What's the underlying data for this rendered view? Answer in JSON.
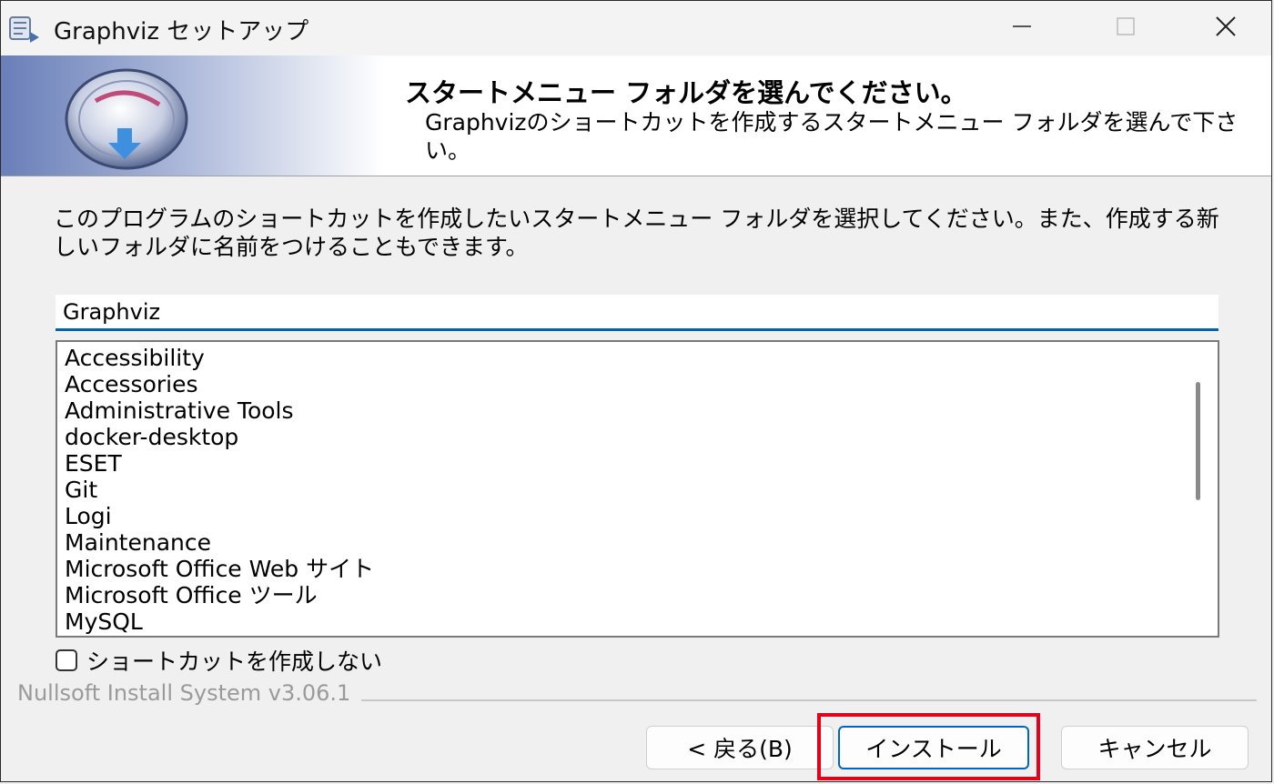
{
  "window": {
    "title": "Graphviz セットアップ",
    "icons": {
      "app": "installer-icon",
      "minimize": "minimize-icon",
      "maximize": "maximize-icon",
      "close": "close-icon"
    }
  },
  "banner": {
    "title": "スタートメニュー フォルダを選んでください。",
    "subtitle": "Graphvizのショートカットを作成するスタートメニュー フォルダを選んで下さい。"
  },
  "description": "このプログラムのショートカットを作成したいスタートメニュー フォルダを選択してください。また、作成する新しいフォルダに名前をつけることもできます。",
  "folder_input": {
    "value": "Graphviz"
  },
  "folder_list": [
    "Accessibility",
    "Accessories",
    "Administrative Tools",
    "docker-desktop",
    "ESET",
    "Git",
    "Logi",
    "Maintenance",
    "Microsoft Office Web サイト",
    "Microsoft Office ツール",
    "MySQL"
  ],
  "no_shortcut_checkbox": {
    "label": "ショートカットを作成しない",
    "checked": false
  },
  "footer": {
    "branding": "Nullsoft Install System v3.06.1"
  },
  "buttons": {
    "back": "< 戻る(B)",
    "install": "インストール",
    "cancel": "キャンセル"
  },
  "colors": {
    "accent": "#0063b1",
    "highlight": "#e6001a"
  }
}
